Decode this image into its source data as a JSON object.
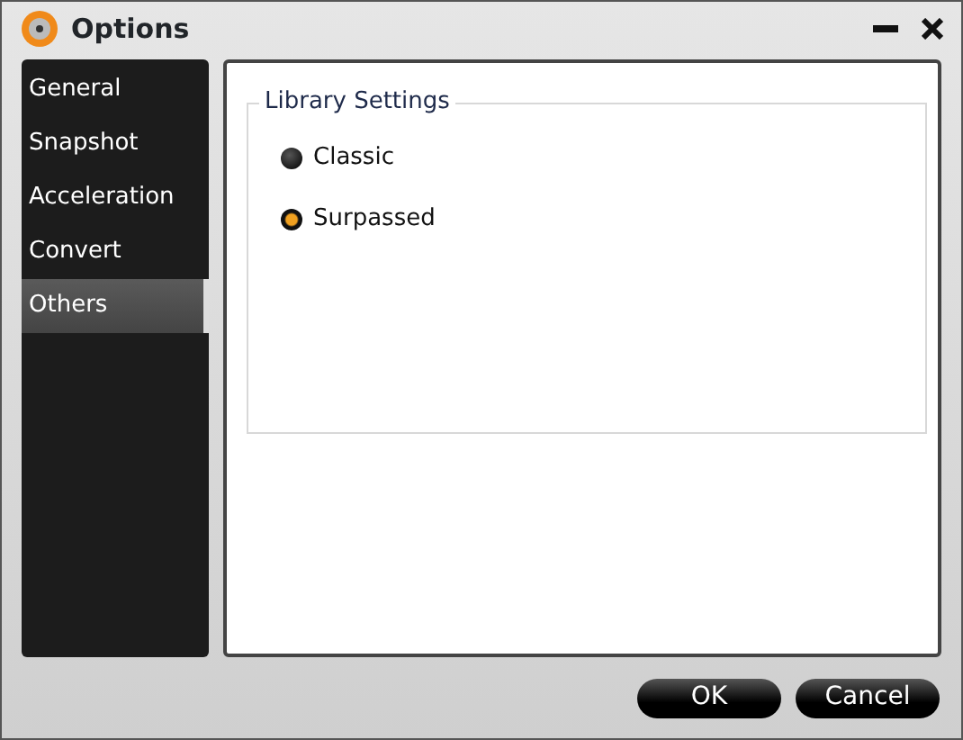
{
  "window": {
    "title": "Options"
  },
  "sidebar": {
    "items": [
      {
        "label": "General",
        "selected": false
      },
      {
        "label": "Snapshot",
        "selected": false
      },
      {
        "label": "Acceleration",
        "selected": false
      },
      {
        "label": "Convert",
        "selected": false
      },
      {
        "label": "Others",
        "selected": true
      }
    ]
  },
  "group": {
    "title": "Library Settings",
    "options": [
      {
        "label": "Classic",
        "selected": false
      },
      {
        "label": "Surpassed",
        "selected": true
      }
    ]
  },
  "buttons": [
    "OK",
    "Cancel"
  ]
}
